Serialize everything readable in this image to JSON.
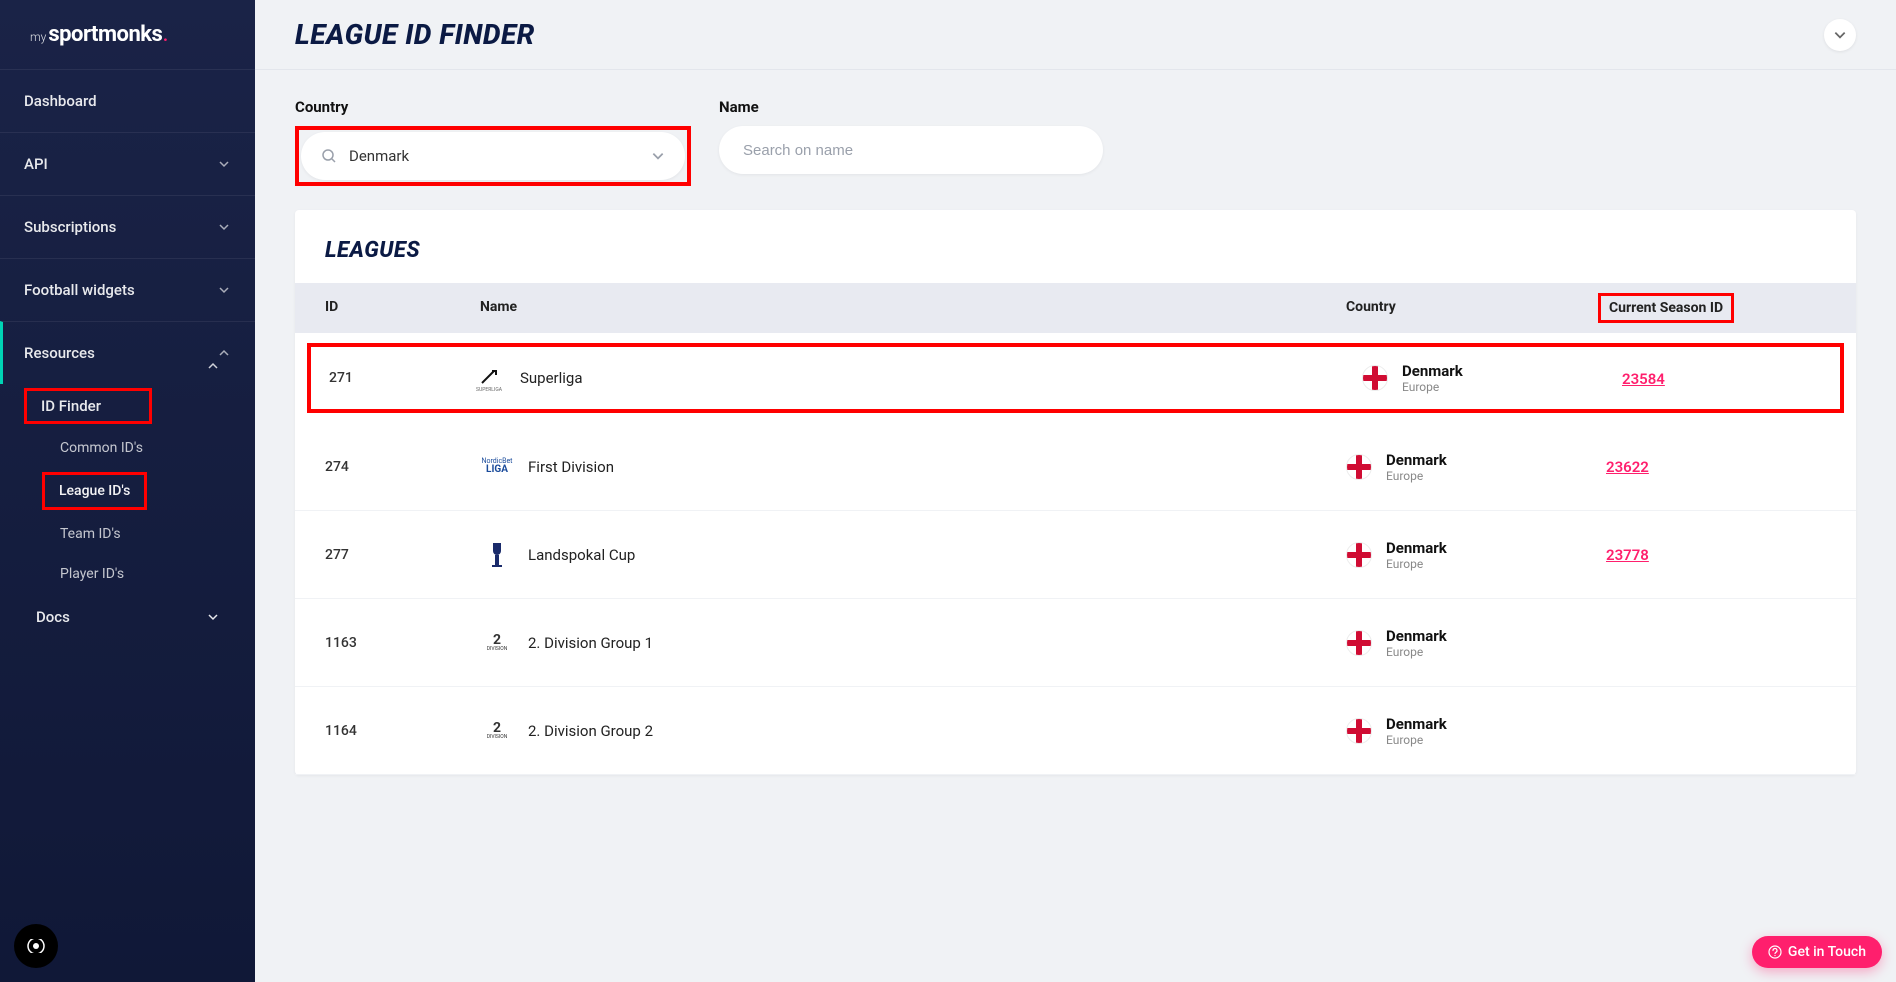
{
  "logo": {
    "prefix": "my",
    "main": "sportmonks"
  },
  "sidebar": {
    "dashboard": "Dashboard",
    "api": "API",
    "subscriptions": "Subscriptions",
    "football_widgets": "Football widgets",
    "resources": "Resources",
    "id_finder": "ID Finder",
    "common_ids": "Common ID's",
    "league_ids": "League ID's",
    "team_ids": "Team ID's",
    "player_ids": "Player ID's",
    "docs": "Docs"
  },
  "page": {
    "title": "LEAGUE ID FINDER"
  },
  "filters": {
    "country_label": "Country",
    "country_value": "Denmark",
    "name_label": "Name",
    "name_placeholder": "Search on name"
  },
  "table": {
    "title": "LEAGUES",
    "headers": {
      "id": "ID",
      "name": "Name",
      "country": "Country",
      "season": "Current Season ID"
    },
    "rows": [
      {
        "id": "271",
        "name": "Superliga",
        "logo_hint": "SUPERLIGA",
        "country": "Denmark",
        "region": "Europe",
        "season_id": "23584",
        "highlight": true
      },
      {
        "id": "274",
        "name": "First Division",
        "logo_hint": "NordicBet LIGA",
        "country": "Denmark",
        "region": "Europe",
        "season_id": "23622",
        "highlight": false
      },
      {
        "id": "277",
        "name": "Landspokal Cup",
        "logo_hint": "cup",
        "country": "Denmark",
        "region": "Europe",
        "season_id": "23778",
        "highlight": false
      },
      {
        "id": "1163",
        "name": "2. Division Group 1",
        "logo_hint": "2 DIVISION",
        "country": "Denmark",
        "region": "Europe",
        "season_id": "",
        "highlight": false
      },
      {
        "id": "1164",
        "name": "2. Division Group 2",
        "logo_hint": "2 DIVISION",
        "country": "Denmark",
        "region": "Europe",
        "season_id": "",
        "highlight": false
      }
    ]
  },
  "buttons": {
    "get_in_touch": "Get in Touch"
  }
}
